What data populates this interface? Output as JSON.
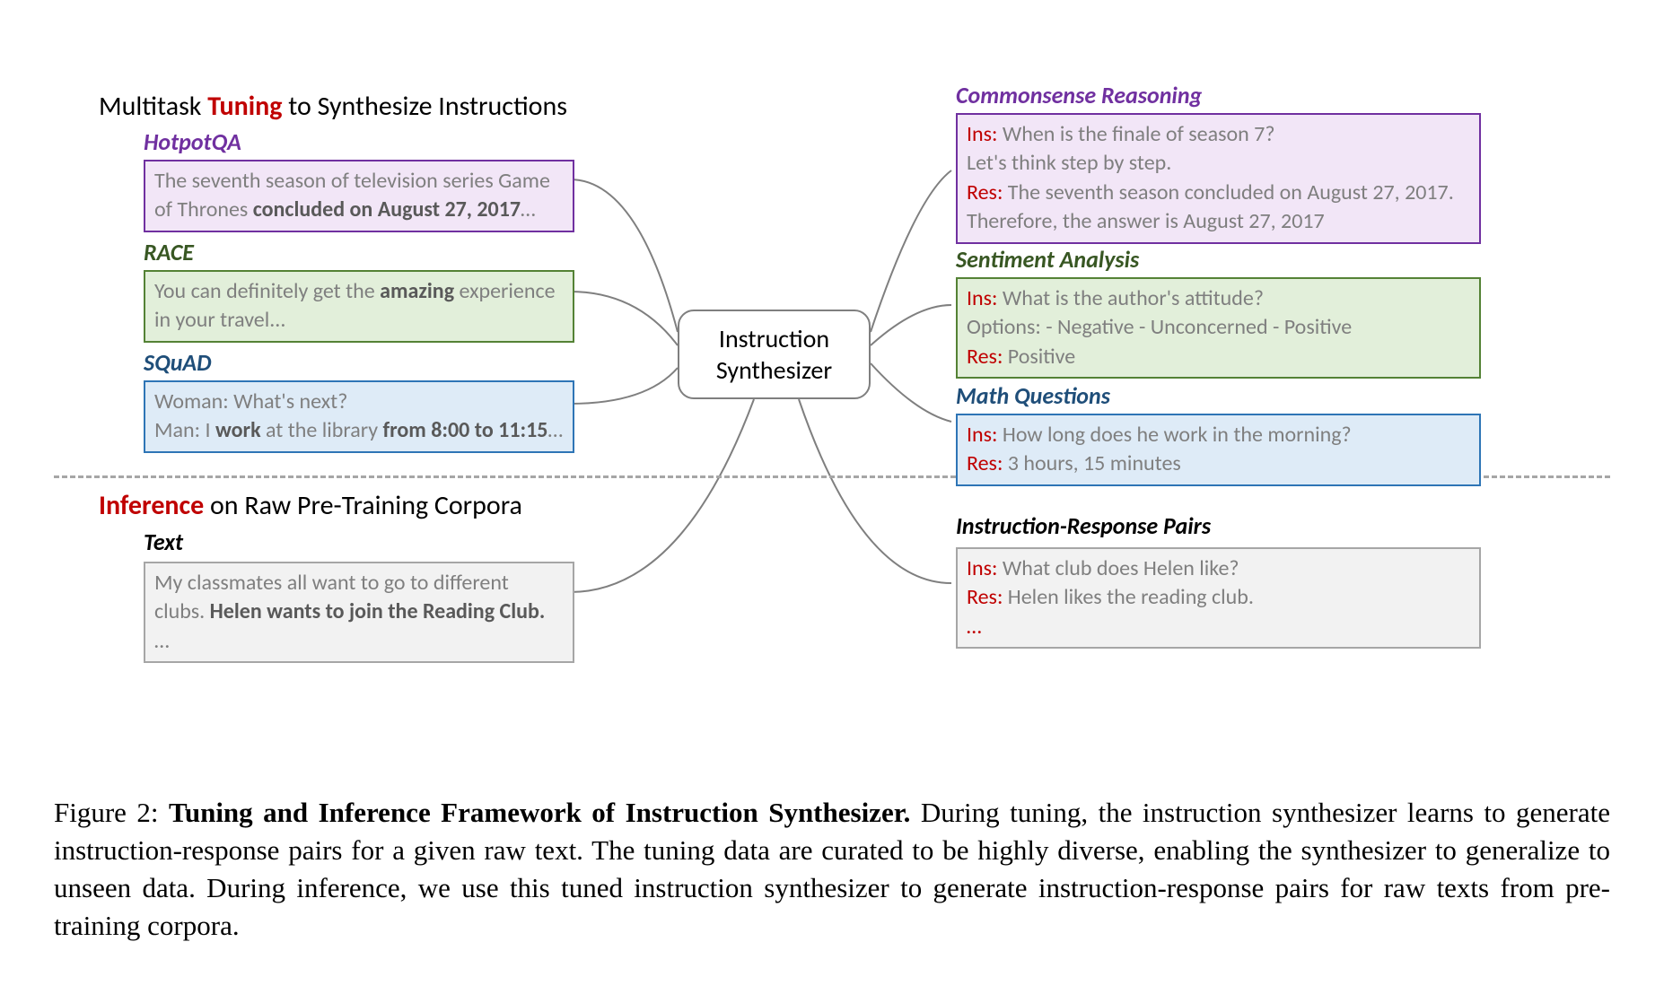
{
  "titles": {
    "multitask_prefix": "Multitask ",
    "multitask_highlight": "Tuning",
    "multitask_suffix": " to Synthesize Instructions",
    "inference_highlight": "Inference",
    "inference_suffix": " on Raw Pre-Training Corpora"
  },
  "center": {
    "line1": "Instruction",
    "line2": "Synthesizer"
  },
  "left": {
    "hotpot_label": "HotpotQA",
    "hotpot_a": "The seventh season of television series Game of Thrones ",
    "hotpot_b": "concluded on August 27, 2017",
    "hotpot_c": "…",
    "race_label": "RACE",
    "race_a": "You can definitely get the ",
    "race_b": "amazing",
    "race_c": " experience in your travel...",
    "squad_label": "SQuAD",
    "squad_a": "Woman: What's next?",
    "squad_b_pre": "Man: I ",
    "squad_b_bold1": "work",
    "squad_b_mid": " at the library ",
    "squad_b_bold2": "from 8:00 to 11:15",
    "squad_b_post": "…",
    "text_label": "Text",
    "text_a": "My classmates all want to go to different clubs. ",
    "text_b": "Helen wants to join the Reading Club.",
    "text_c": " …"
  },
  "right": {
    "commonsense_label": "Commonsense Reasoning",
    "cs_ins": "Ins:",
    "cs_ins_text": " When is the finale of season 7?",
    "cs_ins_text2": "Let's think step by step.",
    "cs_res": "Res:",
    "cs_res_text": " The seventh season concluded on August 27, 2017. Therefore, the answer is August 27, 2017",
    "sentiment_label": "Sentiment Analysis",
    "sa_ins": "Ins:",
    "sa_ins_text": " What is the author's attitude?",
    "sa_opts": "Options: - Negative - Unconcerned - Positive",
    "sa_res": "Res:",
    "sa_res_text": " Positive",
    "math_label": "Math Questions",
    "mq_ins": "Ins:",
    "mq_ins_text": " How long does he work in the morning?",
    "mq_res": "Res:",
    "mq_res_text": " 3 hours, 15 minutes",
    "pairs_label": "Instruction-Response Pairs",
    "pr_ins": "Ins:",
    "pr_ins_text": " What club does Helen like?",
    "pr_res": "Res:",
    "pr_res_text": " Helen likes the reading club.",
    "pr_more": "…"
  },
  "caption": {
    "prefix": "Figure 2: ",
    "bold": "Tuning and Inference Framework of Instruction Synthesizer.",
    "rest": " During tuning, the instruction synthesizer learns to generate instruction-response pairs for a given raw text. The tuning data are curated to be highly diverse, enabling the synthesizer to generalize to unseen data. During inference, we use this tuned instruction synthesizer to generate instruction-response pairs for raw texts from pre-training corpora."
  }
}
